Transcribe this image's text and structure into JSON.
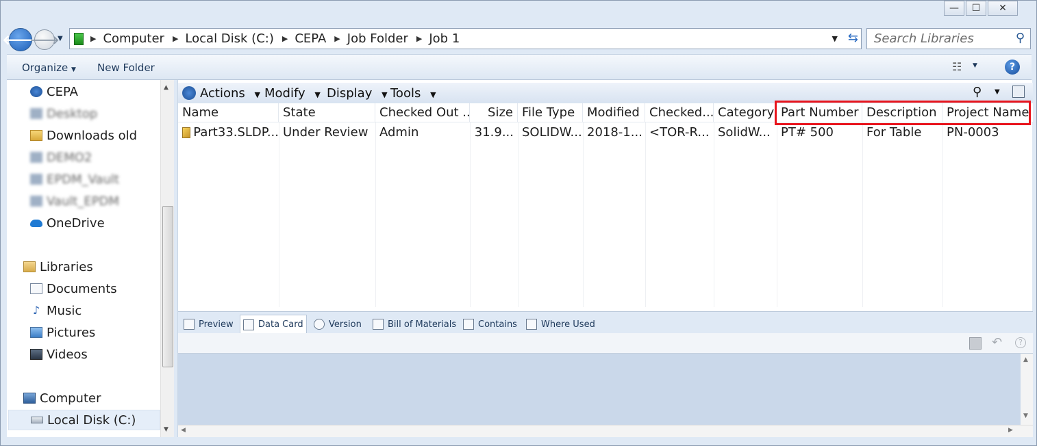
{
  "window": {
    "controls": {
      "minimize": "—",
      "maximize": "☐",
      "close": "✕"
    }
  },
  "address_bar": {
    "crumbs": [
      "Computer",
      "Local Disk (C:)",
      "CEPA",
      "Job Folder",
      "Job 1"
    ],
    "search_placeholder": "Search Libraries"
  },
  "command_bar": {
    "organize": "Organize",
    "new_folder": "New Folder"
  },
  "nav": {
    "items": [
      {
        "label": "CEPA",
        "icon": "vault-icon"
      },
      {
        "label": "Desktop",
        "icon": "vault-icon",
        "blurred": true
      },
      {
        "label": "Downloads old",
        "icon": "folder-icon"
      },
      {
        "label": "DEMO2",
        "icon": "vault-icon",
        "blurred": true
      },
      {
        "label": "EPDM_Vault",
        "icon": "vault-icon",
        "blurred": true
      },
      {
        "label": "Vault_EPDM",
        "icon": "vault-icon",
        "blurred": true
      },
      {
        "label": "OneDrive",
        "icon": "cloud-icon"
      },
      {
        "label": "Libraries",
        "icon": "libraries-icon"
      },
      {
        "label": "Documents",
        "icon": "documents-icon"
      },
      {
        "label": "Music",
        "icon": "music-icon"
      },
      {
        "label": "Pictures",
        "icon": "pictures-icon"
      },
      {
        "label": "Videos",
        "icon": "videos-icon"
      },
      {
        "label": "Computer",
        "icon": "computer-icon"
      },
      {
        "label": "Local Disk (C:)",
        "icon": "drive-icon"
      }
    ]
  },
  "pdm_toolbar": {
    "menus": [
      "Actions",
      "Modify",
      "Display",
      "Tools"
    ]
  },
  "table": {
    "columns": [
      "Name",
      "State",
      "Checked Out ...",
      "Size",
      "File Type",
      "Modified",
      "Checked...",
      "Category",
      "Part Number",
      "Description",
      "Project Name"
    ],
    "rows": [
      [
        "Part33.SLDP...",
        "Under Review",
        "Admin",
        "31.9...",
        "SOLIDW...",
        "2018-1...",
        "<TOR-R...",
        "SolidW...",
        "PT# 500",
        "For Table",
        "PN-0003"
      ]
    ]
  },
  "lower_tabs": [
    "Preview",
    "Data Card",
    "Version",
    "Bill of Materials",
    "Contains",
    "Where Used"
  ],
  "colors": {
    "highlight": "#e8141c",
    "accent": "#1e395b"
  }
}
